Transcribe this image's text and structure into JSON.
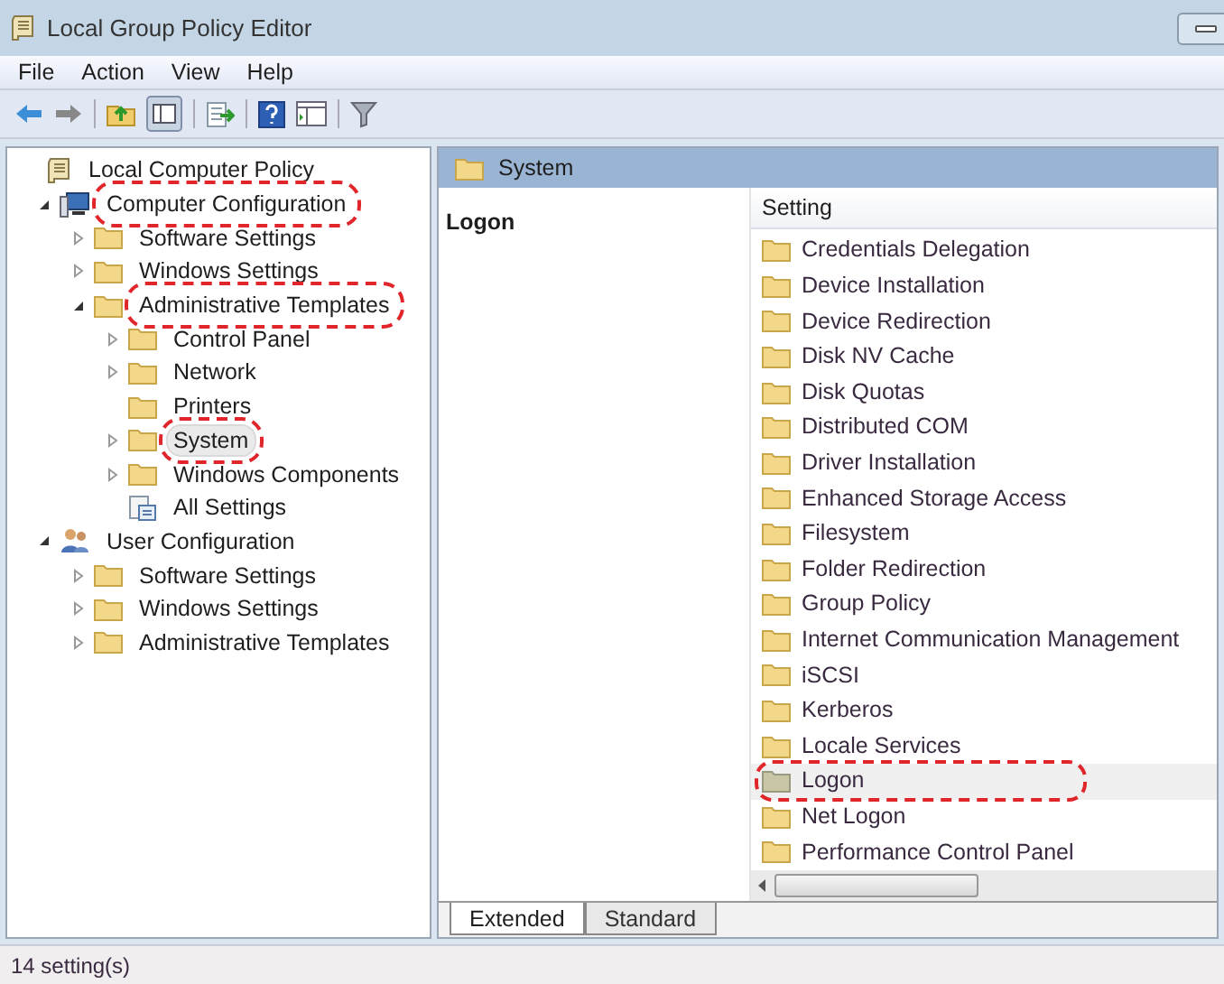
{
  "window": {
    "title": "Local Group Policy Editor"
  },
  "menu": [
    "File",
    "Action",
    "View",
    "Help"
  ],
  "tree": [
    {
      "label": "Local Computer Policy",
      "kind": "policy",
      "selected": false,
      "circled": false,
      "children": [
        {
          "label": "Computer Configuration",
          "kind": "computer",
          "expanded": true,
          "selected": false,
          "circled": true,
          "children": [
            {
              "label": "Software Settings",
              "kind": "folder",
              "expanded": false,
              "selected": false,
              "circled": false
            },
            {
              "label": "Windows Settings",
              "kind": "folder",
              "expanded": false,
              "selected": false,
              "circled": false
            },
            {
              "label": "Administrative Templates",
              "kind": "folder",
              "expanded": true,
              "selected": false,
              "circled": true,
              "children": [
                {
                  "label": "Control Panel",
                  "kind": "folder",
                  "expanded": false,
                  "selected": false,
                  "circled": false
                },
                {
                  "label": "Network",
                  "kind": "folder",
                  "expanded": false,
                  "selected": false,
                  "circled": false
                },
                {
                  "label": "Printers",
                  "kind": "folder",
                  "selected": false,
                  "circled": false
                },
                {
                  "label": "System",
                  "kind": "folder",
                  "expanded": false,
                  "selected": true,
                  "circled": true
                },
                {
                  "label": "Windows Components",
                  "kind": "folder",
                  "expanded": false,
                  "selected": false,
                  "circled": false
                },
                {
                  "label": "All Settings",
                  "kind": "settings",
                  "selected": false,
                  "circled": false
                }
              ]
            }
          ]
        },
        {
          "label": "User Configuration",
          "kind": "user",
          "expanded": true,
          "selected": false,
          "circled": false,
          "children": [
            {
              "label": "Software Settings",
              "kind": "folder",
              "expanded": false,
              "selected": false,
              "circled": false
            },
            {
              "label": "Windows Settings",
              "kind": "folder",
              "expanded": false,
              "selected": false,
              "circled": false
            },
            {
              "label": "Administrative Templates",
              "kind": "folder",
              "expanded": false,
              "selected": false,
              "circled": false
            }
          ]
        }
      ]
    }
  ],
  "details": {
    "header": "System",
    "description_title": "Logon",
    "column": "Setting",
    "items": [
      {
        "label": "Credentials Delegation",
        "selected": false,
        "circled": false
      },
      {
        "label": "Device Installation",
        "selected": false,
        "circled": false
      },
      {
        "label": "Device Redirection",
        "selected": false,
        "circled": false
      },
      {
        "label": "Disk NV Cache",
        "selected": false,
        "circled": false
      },
      {
        "label": "Disk Quotas",
        "selected": false,
        "circled": false
      },
      {
        "label": "Distributed COM",
        "selected": false,
        "circled": false
      },
      {
        "label": "Driver Installation",
        "selected": false,
        "circled": false
      },
      {
        "label": "Enhanced Storage Access",
        "selected": false,
        "circled": false
      },
      {
        "label": "Filesystem",
        "selected": false,
        "circled": false
      },
      {
        "label": "Folder Redirection",
        "selected": false,
        "circled": false
      },
      {
        "label": "Group Policy",
        "selected": false,
        "circled": false
      },
      {
        "label": "Internet Communication Management",
        "selected": false,
        "circled": false
      },
      {
        "label": "iSCSI",
        "selected": false,
        "circled": false
      },
      {
        "label": "Kerberos",
        "selected": false,
        "circled": false
      },
      {
        "label": "Locale Services",
        "selected": false,
        "circled": false
      },
      {
        "label": "Logon",
        "selected": true,
        "circled": true
      },
      {
        "label": "Net Logon",
        "selected": false,
        "circled": false
      },
      {
        "label": "Performance Control Panel",
        "selected": false,
        "circled": false
      }
    ],
    "tabs": [
      {
        "label": "Extended",
        "selected": true
      },
      {
        "label": "Standard",
        "selected": false
      }
    ]
  },
  "status_bar": "14 setting(s)"
}
